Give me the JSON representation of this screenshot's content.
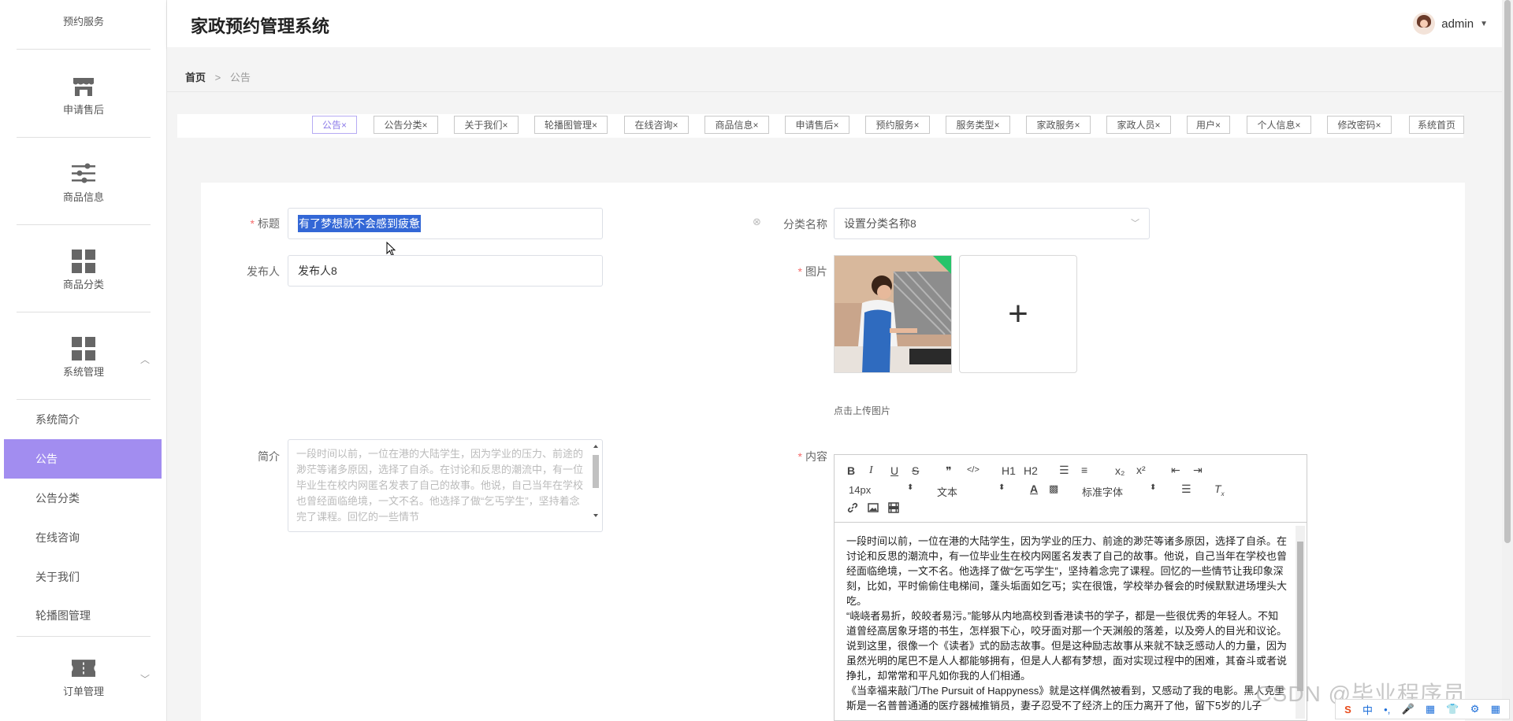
{
  "app": {
    "title": "家政预约管理系统",
    "user": "admin",
    "caret": "▼"
  },
  "sidebar": {
    "items": [
      {
        "label": "预约服务",
        "icon": "calendar-icon"
      },
      {
        "label": "申请售后",
        "icon": "shop-icon"
      },
      {
        "label": "商品信息",
        "icon": "sliders-icon"
      },
      {
        "label": "商品分类",
        "icon": "grid-icon"
      },
      {
        "label": "系统管理",
        "icon": "grid-icon"
      },
      {
        "label": "订单管理",
        "icon": "ticket-icon"
      }
    ],
    "sub_items": [
      "系统简介",
      "公告",
      "公告分类",
      "在线咨询",
      "关于我们",
      "轮播图管理"
    ],
    "active_sub": "公告"
  },
  "breadcrumb": {
    "home": "首页",
    "sep": ">",
    "current": "公告"
  },
  "tabs": [
    "公告",
    "公告分类",
    "关于我们",
    "轮播图管理",
    "在线咨询",
    "商品信息",
    "申请售后",
    "预约服务",
    "服务类型",
    "家政服务",
    "家政人员",
    "用户",
    "个人信息",
    "修改密码",
    "系统首页"
  ],
  "form": {
    "title_label": "标题",
    "title_value": "有了梦想就不会感到疲惫",
    "publisher_label": "发布人",
    "publisher_value": "发布人8",
    "category_label": "分类名称",
    "category_value": "设置分类名称8",
    "image_label": "图片",
    "upload_hint": "点击上传图片",
    "upload_plus": "+",
    "summary_label": "简介",
    "summary_value": "一段时间以前，一位在港的大陆学生，因为学业的压力、前途的渺茫等诸多原因，选择了自杀。在讨论和反思的潮流中，有一位毕业生在校内网匿名发表了自己的故事。他说，自己当年在学校也曾经面临绝境，一文不名。他选择了做“乞丐学生”，坚持着念完了课程。回忆的一些情节",
    "content_label": "内容"
  },
  "editor": {
    "toolbar_row1": [
      "B",
      "I",
      "U",
      "S",
      "❞",
      "</>",
      "H1",
      "H2",
      "☰",
      "≡",
      "x₂",
      "x²",
      "⇤",
      "⇥"
    ],
    "font_size": "14px",
    "block_type": "文本",
    "font_family": "标准字体",
    "paragraphs": [
      "一段时间以前，一位在港的大陆学生，因为学业的压力、前途的渺茫等诸多原因，选择了自杀。在讨论和反思的潮流中，有一位毕业生在校内网匿名发表了自己的故事。他说，自己当年在学校也曾经面临绝境，一文不名。他选择了做“乞丐学生”，坚持着念完了课程。回忆的一些情节让我印象深刻，比如，平时偷偷住电梯间，蓬头垢面如乞丐；实在很饿，学校举办餐会的时候默默进场埋头大吃。",
      "“峣峣者易折，皎皎者易污。”能够从内地高校到香港读书的学子，都是一些很优秀的年轻人。不知道曾经高居象牙塔的书生，怎样狠下心，咬牙面对那一个天渊般的落差，以及旁人的目光和议论。",
      "说到这里，很像一个《读者》式的励志故事。但是这种励志故事从来就不缺乏感动人的力量，因为虽然光明的尾巴不是人人都能够拥有，但是人人都有梦想，面对实现过程中的困难，其奋斗或者说挣扎，却常常和平凡如你我的人们相通。",
      "《当幸福来敲门/The Pursuit of Happyness》就是这样偶然被看到，又感动了我的电影。黑人克里斯是一名普普通通的医疗器械推销员，妻子忍受不了经济上的压力离开了他，留下5岁的儿子"
    ]
  },
  "watermark": "CSDN @毕业程序员",
  "ime": [
    "S",
    "中",
    "•,",
    "🎤",
    "▦",
    "👕",
    "⚙",
    "▦"
  ]
}
